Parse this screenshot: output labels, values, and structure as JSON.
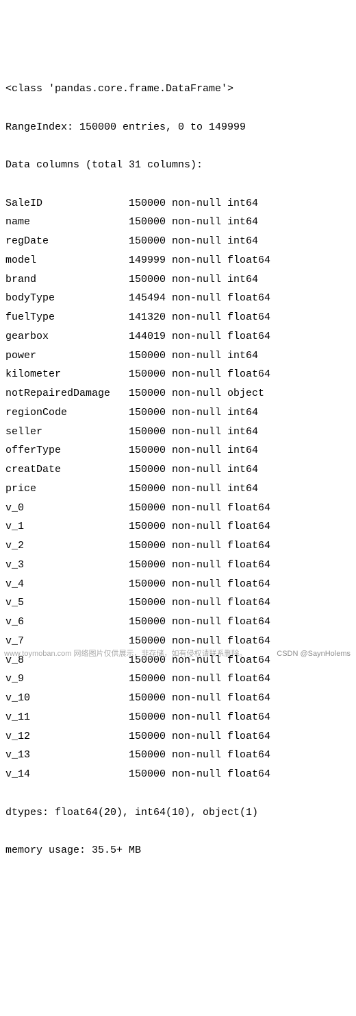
{
  "header": {
    "class_line": "<class 'pandas.core.frame.DataFrame'>",
    "range_line": "RangeIndex: 150000 entries, 0 to 149999",
    "columns_line": "Data columns (total 31 columns):"
  },
  "columns": [
    {
      "name": "SaleID",
      "count": "150000",
      "null": "non-null",
      "dtype": "int64"
    },
    {
      "name": "name",
      "count": "150000",
      "null": "non-null",
      "dtype": "int64"
    },
    {
      "name": "regDate",
      "count": "150000",
      "null": "non-null",
      "dtype": "int64"
    },
    {
      "name": "model",
      "count": "149999",
      "null": "non-null",
      "dtype": "float64"
    },
    {
      "name": "brand",
      "count": "150000",
      "null": "non-null",
      "dtype": "int64"
    },
    {
      "name": "bodyType",
      "count": "145494",
      "null": "non-null",
      "dtype": "float64"
    },
    {
      "name": "fuelType",
      "count": "141320",
      "null": "non-null",
      "dtype": "float64"
    },
    {
      "name": "gearbox",
      "count": "144019",
      "null": "non-null",
      "dtype": "float64"
    },
    {
      "name": "power",
      "count": "150000",
      "null": "non-null",
      "dtype": "int64"
    },
    {
      "name": "kilometer",
      "count": "150000",
      "null": "non-null",
      "dtype": "float64"
    },
    {
      "name": "notRepairedDamage",
      "count": "150000",
      "null": "non-null",
      "dtype": "object"
    },
    {
      "name": "regionCode",
      "count": "150000",
      "null": "non-null",
      "dtype": "int64"
    },
    {
      "name": "seller",
      "count": "150000",
      "null": "non-null",
      "dtype": "int64"
    },
    {
      "name": "offerType",
      "count": "150000",
      "null": "non-null",
      "dtype": "int64"
    },
    {
      "name": "creatDate",
      "count": "150000",
      "null": "non-null",
      "dtype": "int64"
    },
    {
      "name": "price",
      "count": "150000",
      "null": "non-null",
      "dtype": "int64"
    },
    {
      "name": "v_0",
      "count": "150000",
      "null": "non-null",
      "dtype": "float64"
    },
    {
      "name": "v_1",
      "count": "150000",
      "null": "non-null",
      "dtype": "float64"
    },
    {
      "name": "v_2",
      "count": "150000",
      "null": "non-null",
      "dtype": "float64"
    },
    {
      "name": "v_3",
      "count": "150000",
      "null": "non-null",
      "dtype": "float64"
    },
    {
      "name": "v_4",
      "count": "150000",
      "null": "non-null",
      "dtype": "float64"
    },
    {
      "name": "v_5",
      "count": "150000",
      "null": "non-null",
      "dtype": "float64"
    },
    {
      "name": "v_6",
      "count": "150000",
      "null": "non-null",
      "dtype": "float64"
    },
    {
      "name": "v_7",
      "count": "150000",
      "null": "non-null",
      "dtype": "float64"
    },
    {
      "name": "v_8",
      "count": "150000",
      "null": "non-null",
      "dtype": "float64"
    },
    {
      "name": "v_9",
      "count": "150000",
      "null": "non-null",
      "dtype": "float64"
    },
    {
      "name": "v_10",
      "count": "150000",
      "null": "non-null",
      "dtype": "float64"
    },
    {
      "name": "v_11",
      "count": "150000",
      "null": "non-null",
      "dtype": "float64"
    },
    {
      "name": "v_12",
      "count": "150000",
      "null": "non-null",
      "dtype": "float64"
    },
    {
      "name": "v_13",
      "count": "150000",
      "null": "non-null",
      "dtype": "float64"
    },
    {
      "name": "v_14",
      "count": "150000",
      "null": "non-null",
      "dtype": "float64"
    }
  ],
  "footer": {
    "dtypes_line": "dtypes: float64(20), int64(10), object(1)",
    "memory_line": "memory usage: 35.5+ MB"
  },
  "watermark": {
    "left": "www.toymoban.com 网络图片仅供展示，非存储，如有侵权请联系删除。",
    "right": "CSDN @SaynHolems"
  },
  "layout": {
    "name_width": 20
  }
}
